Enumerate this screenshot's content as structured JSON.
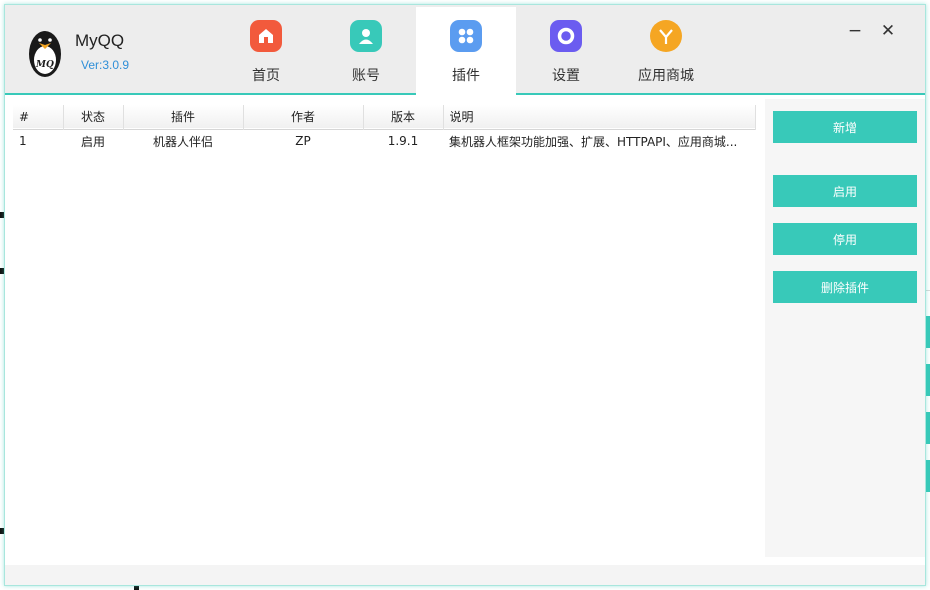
{
  "app": {
    "title": "MyQQ",
    "version": "Ver:3.0.9"
  },
  "tabs": [
    {
      "label": "首页",
      "icon": "home-icon",
      "color": "#f25a3c"
    },
    {
      "label": "账号",
      "icon": "user-icon",
      "color": "#38c9b9"
    },
    {
      "label": "插件",
      "icon": "plugin-grid-icon",
      "color": "#5b9cf0",
      "active": true
    },
    {
      "label": "设置",
      "icon": "settings-ring-icon",
      "color": "#6b5cf0"
    },
    {
      "label": "应用商城",
      "icon": "store-y-icon",
      "color": "#f5a623"
    }
  ],
  "window_controls": {
    "minimize": "−",
    "close": "✕"
  },
  "table": {
    "columns": [
      "#",
      "状态",
      "插件",
      "作者",
      "版本",
      "说明"
    ],
    "rows": [
      [
        "1",
        "启用",
        "机器人伴侣",
        "ZP",
        "1.9.1",
        "集机器人框架功能加强、扩展、HTTPAPI、应用商城..."
      ]
    ]
  },
  "actions": {
    "add": "新增",
    "enable": "启用",
    "disable": "停用",
    "delete": "删除插件"
  },
  "colors": {
    "accent": "#38c9b9",
    "header_bg": "#ededed"
  }
}
